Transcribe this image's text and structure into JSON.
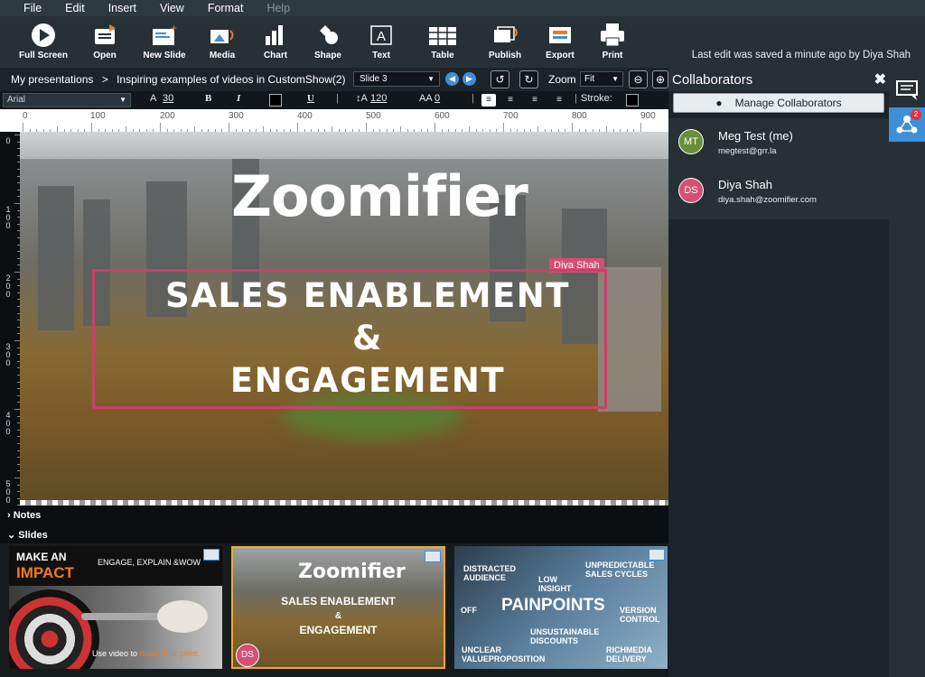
{
  "menu": [
    {
      "label": "File",
      "enabled": true
    },
    {
      "label": "Edit",
      "enabled": true
    },
    {
      "label": "Insert",
      "enabled": true
    },
    {
      "label": "View",
      "enabled": true
    },
    {
      "label": "Format",
      "enabled": true
    },
    {
      "label": "Help",
      "enabled": false
    }
  ],
  "toolbar": {
    "items": [
      {
        "label": "Full Screen",
        "icon": "play-circle-icon"
      },
      {
        "label": "Open",
        "icon": "open-folder-icon"
      },
      {
        "label": "New Slide",
        "icon": "new-slide-icon"
      },
      {
        "label": "Media",
        "icon": "media-icon"
      },
      {
        "label": "Chart",
        "icon": "bar-chart-icon"
      },
      {
        "label": "Shape",
        "icon": "shape-icon"
      },
      {
        "label": "Text",
        "icon": "text-box-icon"
      },
      {
        "label": "Table",
        "icon": "table-icon"
      },
      {
        "label": "Publish",
        "icon": "publish-icon"
      },
      {
        "label": "Export",
        "icon": "export-pptx-icon"
      },
      {
        "label": "Print",
        "icon": "printer-icon"
      }
    ],
    "status": "Last edit was saved a minute ago by Diya Shah"
  },
  "breadcrumb": {
    "root": "My presentations",
    "separator": ">",
    "current": "Inspiring examples of videos in CustomShow(2)"
  },
  "slide_select": "Slide 3",
  "zoom": {
    "label": "Zoom",
    "value": "Fit"
  },
  "format": {
    "font": "Arial",
    "font_size": "30",
    "bold": "B",
    "italic": "I",
    "underline": "U",
    "line_height": "120",
    "letter_spacing": "0",
    "stroke_label": "Stroke:",
    "text_color": "#000000",
    "stroke_color": "#000000"
  },
  "ruler": {
    "h": [
      "0",
      "100",
      "200",
      "300",
      "400",
      "500",
      "600",
      "700",
      "800",
      "900"
    ],
    "v": [
      "0",
      "100",
      "200",
      "300",
      "400",
      "500"
    ]
  },
  "slide": {
    "logo": "Zoomifier",
    "lines": [
      "SALES ENABLEMENT",
      "&",
      "ENGAGEMENT"
    ],
    "editing_user": "Diya Shah",
    "accent": "#c8416a"
  },
  "sections": {
    "notes": "Notes",
    "slides": "Slides"
  },
  "thumbnails": {
    "t1": {
      "title1": "MAKE AN",
      "title2": "IMPACT",
      "tagline": "ENGAGE, EXPLAIN &WOW",
      "caption_pre": "Use video to",
      "caption_accent": "make your point."
    },
    "t2": {
      "logo": "Zoomifier",
      "lines": [
        "SALES ENABLEMENT",
        "&",
        "ENGAGEMENT"
      ],
      "editor_initials": "DS"
    },
    "t3": {
      "title": "PAINPOINTS",
      "words": [
        "DISTRACTED AUDIENCE",
        "LOW INSIGHT",
        "UNPREDICTABLE SALES CYCLES",
        "OFF",
        "VERSION CONTROL",
        "UNSUSTAINABLE DISCOUNTS",
        "UNCLEAR VALUEPROPOSITION",
        "RICHMEDIA DELIVERY"
      ]
    }
  },
  "collaborators": {
    "title": "Collaborators",
    "manage_label": "Manage Collaborators",
    "users": [
      {
        "initials": "MT",
        "name": "Meg Test (me)",
        "email": "megtest@grr.la",
        "color": "#6a8f3a"
      },
      {
        "initials": "DS",
        "name": "Diya Shah",
        "email": "diya.shah@zoomifier.com",
        "color": "#d64f75"
      }
    ]
  },
  "sidebar": {
    "notification_count": "2"
  }
}
